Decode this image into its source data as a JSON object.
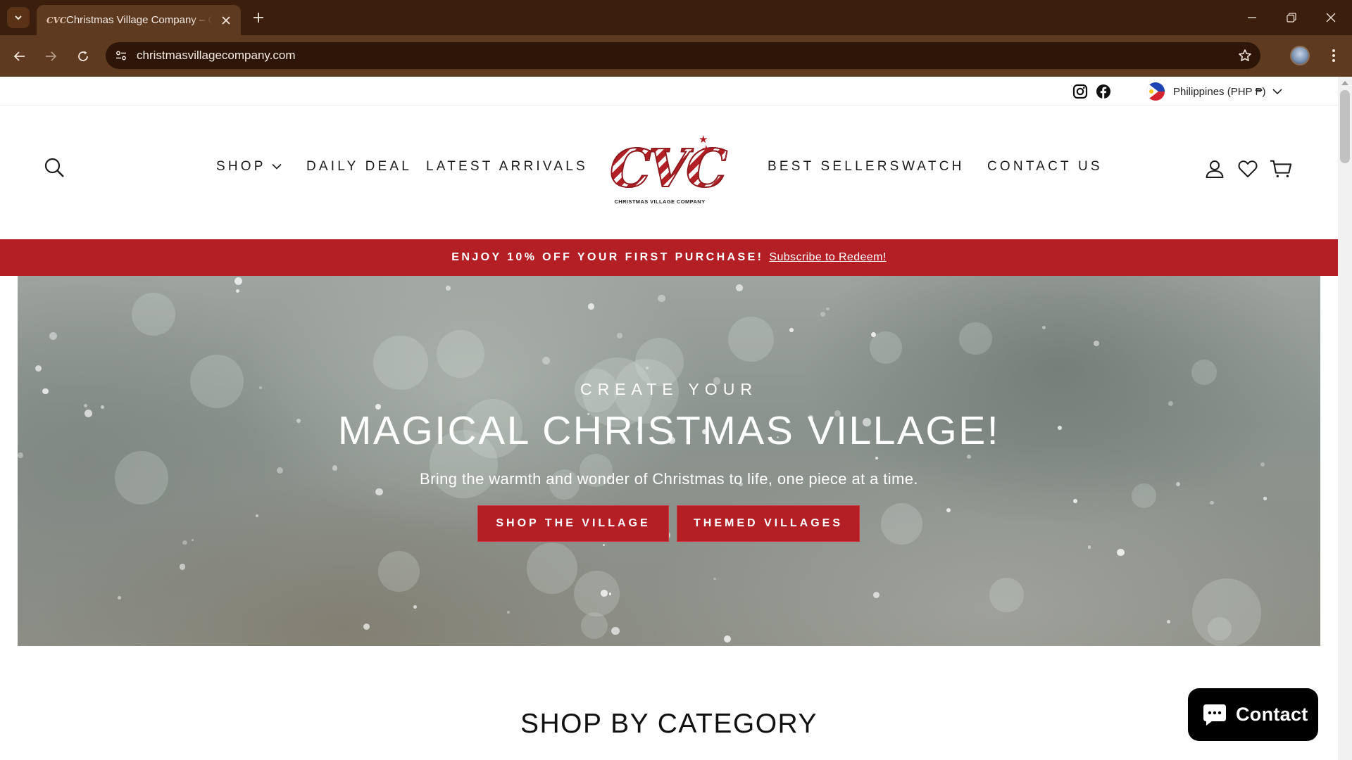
{
  "browser": {
    "tab_title": "Christmas Village Company – Christmas Village Company",
    "favicon_text": "CVC",
    "url": "christmasvillagecompany.com"
  },
  "utility_bar": {
    "country_label": "Philippines (PHP ₱)"
  },
  "nav": {
    "left": [
      "SHOP",
      "DAILY DEAL",
      "LATEST ARRIVALS"
    ],
    "right": [
      "BEST SELLERS",
      "WATCH",
      "CONTACT US"
    ]
  },
  "logo": {
    "mark": "CVC",
    "subtitle": "CHRISTMAS VILLAGE COMPANY"
  },
  "promo": {
    "text": "ENJOY 10% OFF YOUR FIRST PURCHASE!",
    "link": "Subscribe to Redeem!"
  },
  "hero": {
    "kicker": "CREATE YOUR",
    "title": "MAGICAL CHRISTMAS VILLAGE!",
    "subtitle": "Bring the warmth and wonder of Christmas to life, one piece at a time.",
    "buttons": [
      "SHOP THE VILLAGE",
      "THEMED VILLAGES"
    ]
  },
  "section": {
    "title": "SHOP BY CATEGORY"
  },
  "chat": {
    "label": "Contact"
  },
  "colors": {
    "chrome_dark": "#3b1e0b",
    "chrome_toolbar": "#5e3a20",
    "brand_red": "#b31f24"
  },
  "icons": [
    "chevron-down-icon",
    "close-icon",
    "plus-icon",
    "back-arrow-icon",
    "forward-arrow-icon",
    "reload-icon",
    "site-settings-icon",
    "bookmark-star-icon",
    "kebab-menu-icon",
    "instagram-icon",
    "facebook-icon",
    "search-icon",
    "account-icon",
    "heart-icon",
    "cart-icon",
    "chat-bubble-icon"
  ]
}
